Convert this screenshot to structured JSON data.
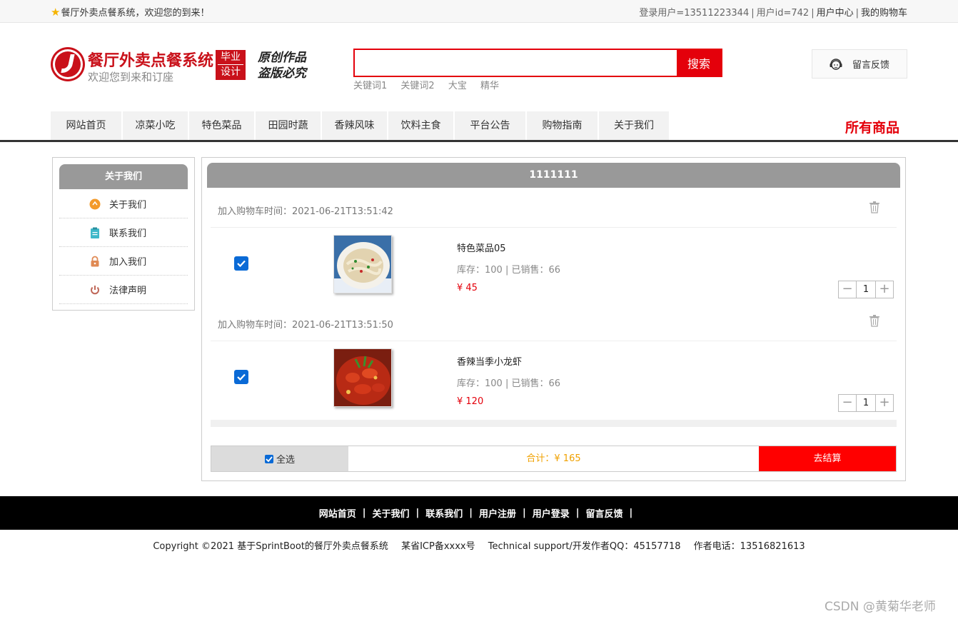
{
  "topbar": {
    "welcome": "餐厅外卖点餐系统，欢迎您的到来！",
    "login_user": "登录用户=13511223344",
    "user_id": "用户id=742",
    "user_center": "用户中心",
    "my_cart": "我的购物车"
  },
  "header": {
    "site_name": "餐厅外卖点餐系统",
    "site_sub": "欢迎您到来和订座",
    "badge_top": "毕业",
    "badge_bottom": "设计",
    "stamp_line1": "原创作品",
    "stamp_line2": "盗版必究",
    "search_button": "搜索",
    "search_value": "",
    "keywords": [
      "关键词1",
      "关键词2",
      "大宝",
      "精华"
    ],
    "feedback": "留言反馈"
  },
  "nav": {
    "items": [
      "网站首页",
      "凉菜小吃",
      "特色菜品",
      "田园时蔬",
      "香辣风味",
      "饮料主食",
      "平台公告",
      "购物指南",
      "关于我们"
    ],
    "all_goods": "所有商品"
  },
  "sidebar": {
    "title": "关于我们",
    "items": [
      "关于我们",
      "联系我们",
      "加入我们",
      "法律声明"
    ]
  },
  "cart": {
    "title": "1111111",
    "items": [
      {
        "time": "加入购物车时间：2021-06-21T13:51:42",
        "name": "特色菜品05",
        "stock": "库存：100 | 已销售：66",
        "price": "¥ 45",
        "qty": "1",
        "checked": true
      },
      {
        "time": "加入购物车时间：2021-06-21T13:51:50",
        "name": "香辣当季小龙虾",
        "stock": "库存：100 | 已销售：66",
        "price": "¥ 120",
        "qty": "1",
        "checked": true
      }
    ],
    "select_all": "全选",
    "total": "合计：¥ 165",
    "checkout": "去结算"
  },
  "footer": {
    "links": [
      "网站首页",
      "关于我们",
      "联系我们",
      "用户注册",
      "用户登录",
      "留言反馈"
    ],
    "copyright": "Copyright ©2021 基于SprintBoot的餐厅外卖点餐系统",
    "icp": "某省ICP备xxxx号",
    "support": "Technical support/开发作者QQ：45157718",
    "phone": "作者电话：13516821613"
  },
  "watermark": "CSDN @黄菊华老师",
  "colors": {
    "accent_red": "#e4000b",
    "checkout_red": "#ff0000",
    "header_gray": "#999999",
    "total_orange": "#f0a100"
  }
}
